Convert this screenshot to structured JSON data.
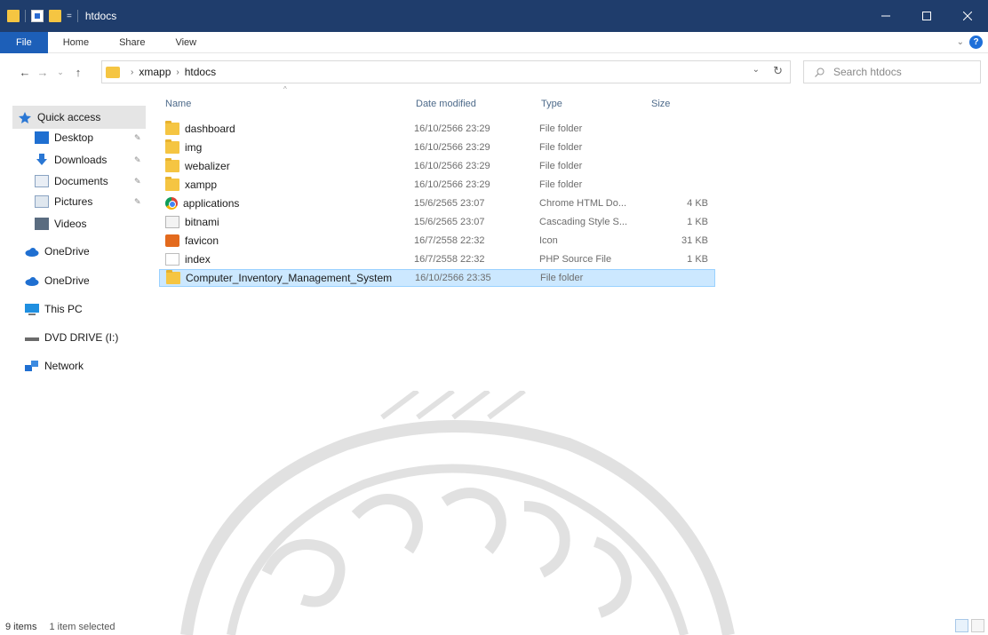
{
  "window": {
    "title": "htdocs",
    "controls": {
      "minimize": "—",
      "maximize": "☐",
      "close": "✕"
    }
  },
  "ribbon": {
    "tabs": [
      "File",
      "Home",
      "Share",
      "View"
    ]
  },
  "address": {
    "crumbs": [
      "xmapp",
      "htdocs"
    ],
    "search_placeholder": "Search htdocs"
  },
  "sidebar": {
    "items": [
      {
        "label": "Quick access",
        "icon": "star-icon"
      },
      {
        "label": "Desktop",
        "icon": "desktop-icon",
        "pinned": true
      },
      {
        "label": "Downloads",
        "icon": "download-icon",
        "pinned": true
      },
      {
        "label": "Documents",
        "icon": "documents-icon",
        "pinned": true
      },
      {
        "label": "Pictures",
        "icon": "pictures-icon",
        "pinned": true
      },
      {
        "label": "Videos",
        "icon": "videos-icon"
      },
      {
        "label": "OneDrive",
        "icon": "cloud-icon"
      },
      {
        "label": "OneDrive",
        "icon": "cloud-icon"
      },
      {
        "label": "This PC",
        "icon": "computer-icon"
      },
      {
        "label": "DVD DRIVE (I:)",
        "icon": "dvd-drive-icon"
      },
      {
        "label": "Network",
        "icon": "network-icon"
      }
    ]
  },
  "columns": {
    "name": "Name",
    "date": "Date modified",
    "type": "Type",
    "size": "Size"
  },
  "files": [
    {
      "name": "dashboard",
      "date": "16/10/2566 23:29",
      "type": "File folder",
      "size": "",
      "icon": "folder-icon"
    },
    {
      "name": "img",
      "date": "16/10/2566 23:29",
      "type": "File folder",
      "size": "",
      "icon": "folder-icon"
    },
    {
      "name": "webalizer",
      "date": "16/10/2566 23:29",
      "type": "File folder",
      "size": "",
      "icon": "folder-icon"
    },
    {
      "name": "xampp",
      "date": "16/10/2566 23:29",
      "type": "File folder",
      "size": "",
      "icon": "folder-icon"
    },
    {
      "name": "applications",
      "date": "15/6/2565 23:07",
      "type": "Chrome HTML Do...",
      "size": "4 KB",
      "icon": "chrome-icon"
    },
    {
      "name": "bitnami",
      "date": "15/6/2565 23:07",
      "type": "Cascading Style S...",
      "size": "1 KB",
      "icon": "css-file-icon"
    },
    {
      "name": "favicon",
      "date": "16/7/2558 22:32",
      "type": "Icon",
      "size": "31 KB",
      "icon": "favicon-icon"
    },
    {
      "name": "index",
      "date": "16/7/2558 22:32",
      "type": "PHP Source File",
      "size": "1 KB",
      "icon": "php-file-icon"
    },
    {
      "name": "Computer_Inventory_Management_System",
      "date": "16/10/2566 23:35",
      "type": "File folder",
      "size": "",
      "icon": "folder-icon",
      "selected": true
    }
  ],
  "status": {
    "items": "9 items",
    "selected": "1 item selected"
  },
  "colors": {
    "titlebar": "#1f3d6c",
    "file_tab": "#1d5fb8",
    "selection": "#cce8ff",
    "folder": "#f5c542"
  }
}
